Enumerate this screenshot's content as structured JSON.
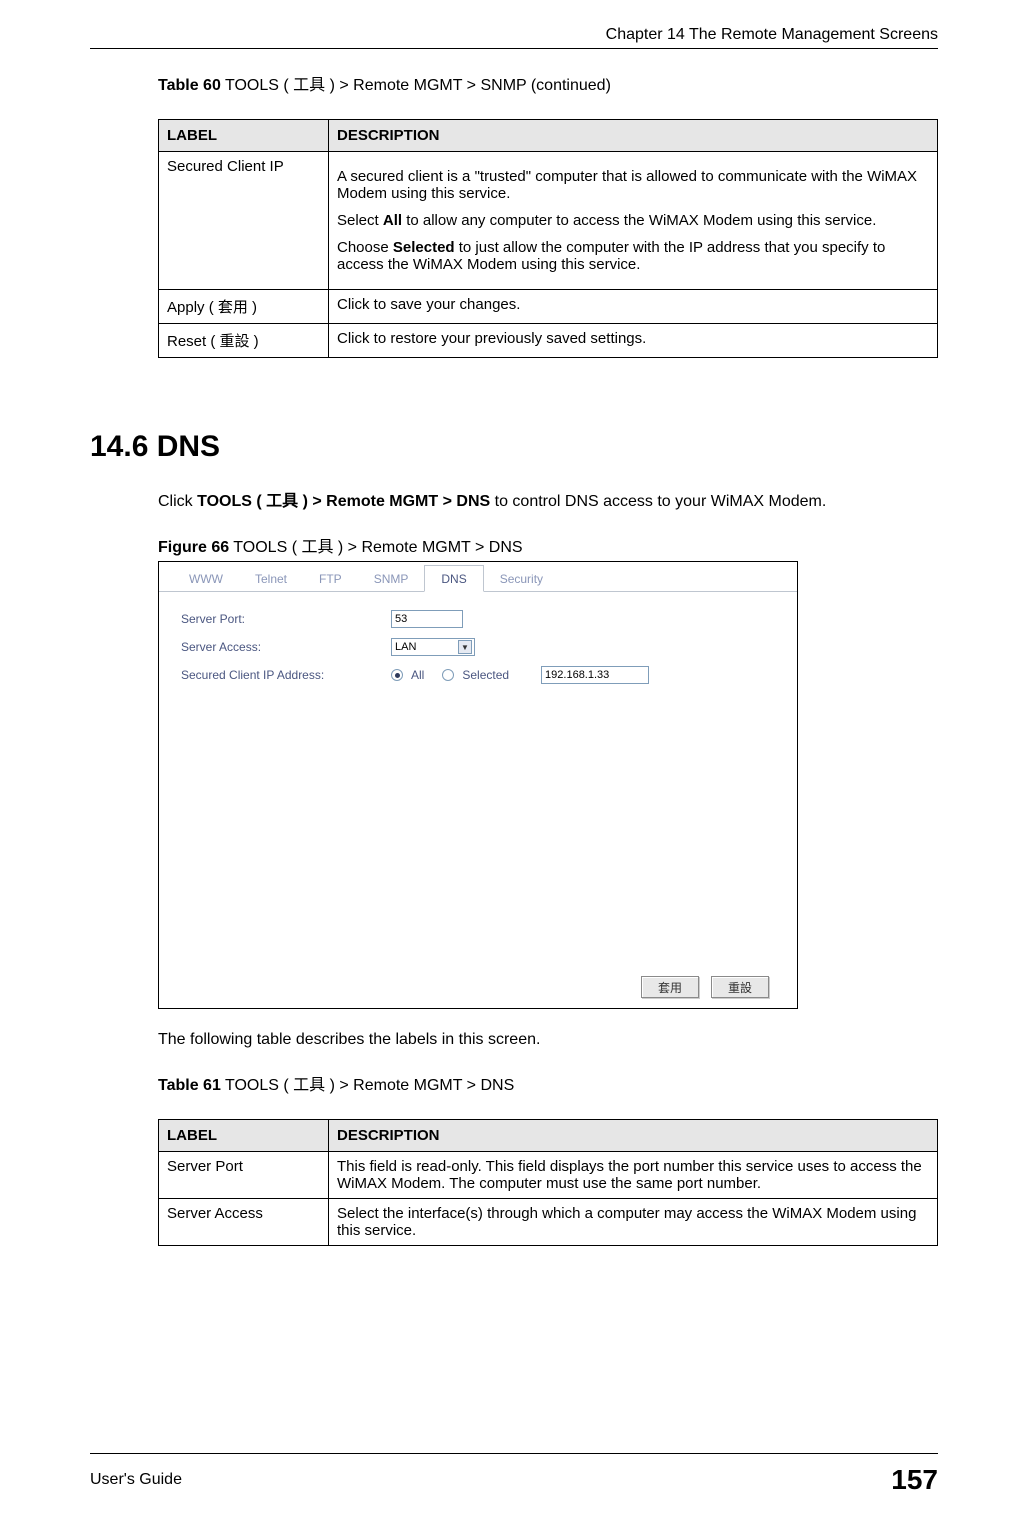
{
  "header": {
    "chapter": "Chapter 14 The Remote Management Screens"
  },
  "table60": {
    "caption_prefix": "Table 60",
    "caption_rest": "   TOOLS ( 工具 ) > Remote MGMT > SNMP (continued)",
    "head_label": "LABEL",
    "head_desc": "DESCRIPTION",
    "rows": [
      {
        "label": "Secured Client IP",
        "desc_p1": "A secured client is a \"trusted\" computer that is allowed to communicate with the WiMAX Modem using this service.",
        "desc_p2_a": "Select ",
        "desc_p2_bold": "All",
        "desc_p2_b": " to allow any computer to access the WiMAX Modem using this service.",
        "desc_p3_a": "Choose ",
        "desc_p3_bold": "Selected",
        "desc_p3_b": " to just allow the computer with the IP address that you specify to access the WiMAX Modem using this service."
      },
      {
        "label": "Apply ( 套用 )",
        "desc": "Click to save your changes."
      },
      {
        "label": "Reset ( 重設 )",
        "desc": "Click to restore your previously saved settings."
      }
    ]
  },
  "section": {
    "heading": "14.6  DNS",
    "intro_a": "Click ",
    "intro_bold": "TOOLS ( 工具 ) > Remote MGMT > DNS",
    "intro_b": " to control DNS access to your WiMAX Modem."
  },
  "figure": {
    "caption_prefix": "Figure 66",
    "caption_rest": "   TOOLS ( 工具 ) > Remote MGMT > DNS",
    "tabs": [
      "WWW",
      "Telnet",
      "FTP",
      "SNMP",
      "DNS",
      "Security"
    ],
    "active_tab": "DNS",
    "server_port_label": "Server Port:",
    "server_port_value": "53",
    "server_access_label": "Server Access:",
    "server_access_value": "LAN",
    "secured_label": "Secured Client IP Address:",
    "radio_all": "All",
    "radio_selected": "Selected",
    "ip_value": "192.168.1.33",
    "btn_apply": "套用",
    "btn_reset": "重設"
  },
  "post_figure": "The following table describes the labels in this screen.",
  "table61": {
    "caption_prefix": "Table 61",
    "caption_rest": "   TOOLS ( 工具 ) > Remote MGMT > DNS",
    "head_label": "LABEL",
    "head_desc": "DESCRIPTION",
    "rows": [
      {
        "label": "Server Port",
        "desc": "This field is read-only. This field displays the port number this service uses to access the WiMAX Modem. The computer must use the same port number."
      },
      {
        "label": "Server Access",
        "desc": "Select the interface(s) through which a computer may access the WiMAX Modem using this service."
      }
    ]
  },
  "footer": {
    "left": "User's Guide",
    "page": "157"
  }
}
